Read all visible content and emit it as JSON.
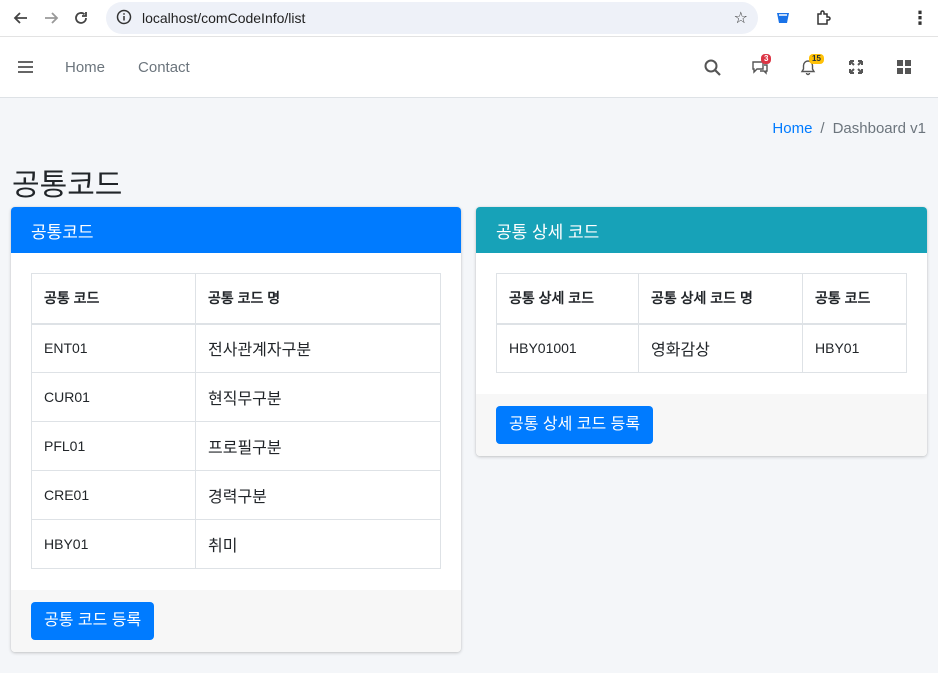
{
  "browser": {
    "url": "localhost/comCodeInfo/list"
  },
  "navbar": {
    "links": [
      "Home",
      "Contact"
    ],
    "messages_badge": "3",
    "notifications_badge": "15"
  },
  "breadcrumb": {
    "home": "Home",
    "separator": "/",
    "current": "Dashboard v1"
  },
  "page_title": "공통코드",
  "left_card": {
    "title": "공통코드",
    "headers": [
      "공통 코드",
      "공통 코드 명"
    ],
    "rows": [
      [
        "ENT01",
        "전사관계자구분"
      ],
      [
        "CUR01",
        "현직무구분"
      ],
      [
        "PFL01",
        "프로필구분"
      ],
      [
        "CRE01",
        "경력구분"
      ],
      [
        "HBY01",
        "취미"
      ]
    ],
    "button": "공통 코드 등록"
  },
  "right_card": {
    "title": "공통 상세 코드",
    "headers": [
      "공통 상세 코드",
      "공통 상세 코드 명",
      "공통 코드"
    ],
    "rows": [
      [
        "HBY01001",
        "영화감상",
        "HBY01"
      ]
    ],
    "button": "공통 상세 코드 등록"
  },
  "colors": {
    "primary": "#007bff",
    "info": "#17a2b8",
    "background": "#f4f6f9"
  }
}
